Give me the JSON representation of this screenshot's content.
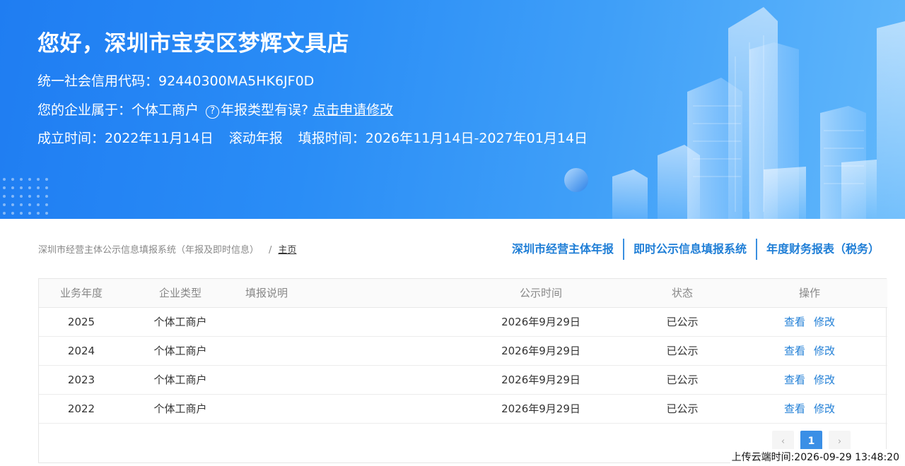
{
  "banner": {
    "greeting": "您好，深圳市宝安区梦辉文具店",
    "credit_code_label": "统一社会信用代码：",
    "credit_code": "92440300MA5HK6JF0D",
    "type_label": "您的企业属于：",
    "type_value": "个体工商户",
    "help_glyph": "?",
    "type_question": "年报类型有误?",
    "apply_link": "点击申请修改",
    "founded_label": "成立时间：",
    "founded_date": "2022年11月14日",
    "report_mode": "滚动年报",
    "period_label": "填报时间：",
    "period_value": "2026年11月14日-2027年01月14日"
  },
  "breadcrumb": {
    "system": "深圳市经营主体公示信息填报系统（年报及即时信息）",
    "separator": "/",
    "home": "主页"
  },
  "top_links": [
    "深圳市经营主体年报",
    "即时公示信息填报系统",
    "年度财务报表（税务）"
  ],
  "table": {
    "headers": {
      "year": "业务年度",
      "type": "企业类型",
      "desc": "填报说明",
      "time": "公示时间",
      "status": "状态",
      "ops": "操作"
    },
    "rows": [
      {
        "year": "2025",
        "type": "个体工商户",
        "desc": "",
        "time": "2026年9月29日",
        "status": "已公示",
        "view": "查看",
        "edit": "修改"
      },
      {
        "year": "2024",
        "type": "个体工商户",
        "desc": "",
        "time": "2026年9月29日",
        "status": "已公示",
        "view": "查看",
        "edit": "修改"
      },
      {
        "year": "2023",
        "type": "个体工商户",
        "desc": "",
        "time": "2026年9月29日",
        "status": "已公示",
        "view": "查看",
        "edit": "修改"
      },
      {
        "year": "2022",
        "type": "个体工商户",
        "desc": "",
        "time": "2026年9月29日",
        "status": "已公示",
        "view": "查看",
        "edit": "修改"
      }
    ]
  },
  "pagination": {
    "prev": "‹",
    "current": "1",
    "next": "›"
  },
  "footer": {
    "upload_time": "上传云端时间:2026-09-29 13:48:20"
  },
  "colors": {
    "banner_start": "#1f7df2",
    "banner_end": "#62b8fb",
    "link": "#1f7ed6",
    "active_page": "#3b8fe6"
  }
}
